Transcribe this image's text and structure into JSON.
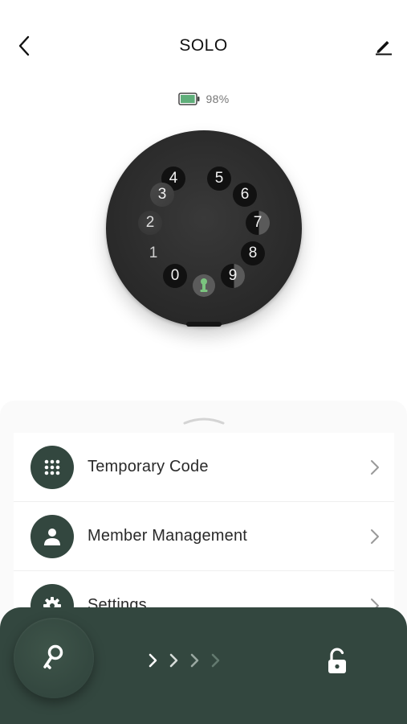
{
  "header": {
    "title": "SOLO",
    "back_icon": "chevron-left-icon",
    "edit_icon": "pencil-icon"
  },
  "battery": {
    "label": "98%",
    "level": 0.98,
    "color": "#5fae7a"
  },
  "keypad": {
    "keys": [
      "0",
      "1",
      "2",
      "3",
      "4",
      "5",
      "6",
      "7",
      "8",
      "9"
    ],
    "center_icon": "keyhole-icon",
    "center_color": "#7bc47f"
  },
  "menu": {
    "items": [
      {
        "label": "Temporary Code",
        "icon": "keypad-grid-icon"
      },
      {
        "label": "Member Management",
        "icon": "person-icon"
      },
      {
        "label": "Settings",
        "icon": "gear-icon"
      }
    ]
  },
  "bottom_bar": {
    "knob_icon": "key-icon",
    "action_icon": "unlocked-padlock-icon",
    "accent": "#33473f"
  }
}
